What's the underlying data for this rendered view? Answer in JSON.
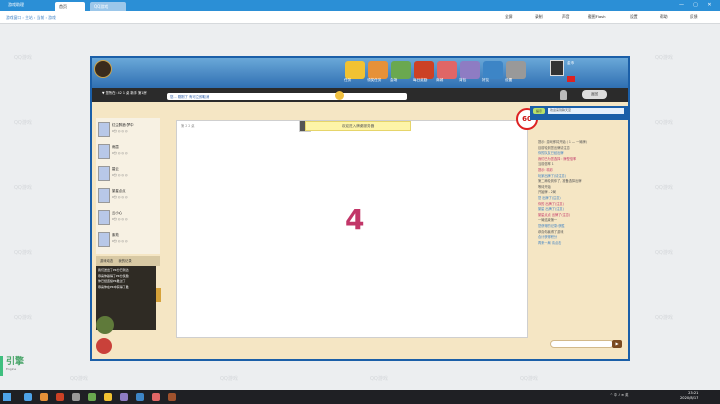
{
  "window": {
    "title": "游戏助理",
    "tabs": [
      "首页",
      "QQ游戏"
    ],
    "controls": [
      "—",
      "▢",
      "✕"
    ]
  },
  "toolbar": {
    "breadcrumb": "游戏窗口 › 主站 › 当前 › 游戏",
    "buttons": [
      "全屏",
      "录制",
      "声音",
      "截图Flash",
      "设置",
      "帮助",
      "反馈"
    ]
  },
  "watermark": "QQ游戏",
  "game": {
    "status_line": "▼ 您所在: 42 1 桌 新手 第1房",
    "message": "您... 刚刚了  有可立即取消",
    "nav": [
      {
        "label": "任务",
        "color": "#f1c232"
      },
      {
        "label": "领奖任务",
        "color": "#e69138"
      },
      {
        "label": "会场",
        "color": "#6aa84f"
      },
      {
        "label": "每日奖励",
        "color": "#cc4125"
      },
      {
        "label": "商城",
        "color": "#e06666"
      },
      {
        "label": "背包",
        "color": "#8e7cc3"
      },
      {
        "label": "好友",
        "color": "#3d85c6"
      },
      {
        "label": "设置",
        "color": "#999999"
      }
    ],
    "user_badge": "金币",
    "recv_button": "返回",
    "notice": "欢迎进入牌桌服务器",
    "room_no": "第 2 2 桌",
    "countdown": "60",
    "big_number": "4",
    "players": [
      {
        "name": "红尘醉酒:梦中",
        "stats": "0分 ◎ ◎ ◎"
      },
      {
        "name": "雨霞",
        "stats": "0分 ◎ ◎ ◎"
      },
      {
        "name": "碧云",
        "stats": "0分 ◎ ◎ ◎"
      },
      {
        "name": "繁星点点",
        "stats": "0分 ◎ ◎ ◎"
      },
      {
        "name": "云小心",
        "stats": "0分 ◎ ◎ ◎"
      },
      {
        "name": "紫苑",
        "stats": "0分 ◎ ◎ ◎"
      }
    ],
    "bottom_tabs": [
      "游戏动态",
      "我的记录"
    ],
    "left_logs": [
      "我们送出了PK分已到达",
      "恭喜你赢得了PK分奖励",
      "你已经连续PK胜过了",
      "恭喜你在PK中获得了胜"
    ],
    "right_header_pill": "提示",
    "right_header_text": "欢迎来到聊天室",
    "right_log": [
      {
        "text": "提示: 游戏即将开始 ( 1 — 一局牌)",
        "cls": ""
      },
      {
        "text": "目前轮到您出牌请注意",
        "cls": ""
      },
      {
        "text": "你的队友已经出牌",
        "cls": "sub"
      },
      {
        "text": "我们已为您选择 : 牌型倍率",
        "cls": "hl"
      },
      {
        "text": "当前倍率 1",
        "cls": ""
      },
      {
        "text": "提示: 精彩",
        "cls": "hl"
      },
      {
        "text": "玩家出牌了(请注意)",
        "cls": "sub"
      },
      {
        "text": "第二局轮到你了, 准备选择出牌",
        "cls": ""
      },
      {
        "text": "等待开始",
        "cls": ""
      },
      {
        "text": "开始牌 - 2局",
        "cls": ""
      },
      {
        "text": "您 出牌了(注意)",
        "cls": "sub"
      },
      {
        "text": "你的 出牌了(注意)",
        "cls": "hl"
      },
      {
        "text": "繁星 出牌了(注意)",
        "cls": "sub"
      },
      {
        "text": "繁星点点 出牌了(注意)",
        "cls": "hl"
      },
      {
        "text": "一局结束第一",
        "cls": ""
      },
      {
        "text": "您获得的记录:获胜",
        "cls": "sub"
      },
      {
        "text": "恭喜你赢得了游戏",
        "cls": ""
      },
      {
        "text": "合计获得积分",
        "cls": "sub"
      },
      {
        "text": "再来一局 请点击",
        "cls": "sub"
      }
    ],
    "send_label": "▶"
  },
  "left_logo": {
    "text": "引擎",
    "sub": "Engine"
  },
  "taskbar": {
    "icons": [
      {
        "color": "#4ea3e8"
      },
      {
        "color": "#e69138"
      },
      {
        "color": "#cc4125"
      },
      {
        "color": "#999999"
      },
      {
        "color": "#6aa84f"
      },
      {
        "color": "#f1c232"
      },
      {
        "color": "#8e7cc3"
      },
      {
        "color": "#3d85c6"
      },
      {
        "color": "#e06666"
      },
      {
        "color": "#a0522d"
      }
    ],
    "tray": "^ 中 ♪ ⊕ 英",
    "time": "23:21",
    "date": "2020/8/17"
  }
}
